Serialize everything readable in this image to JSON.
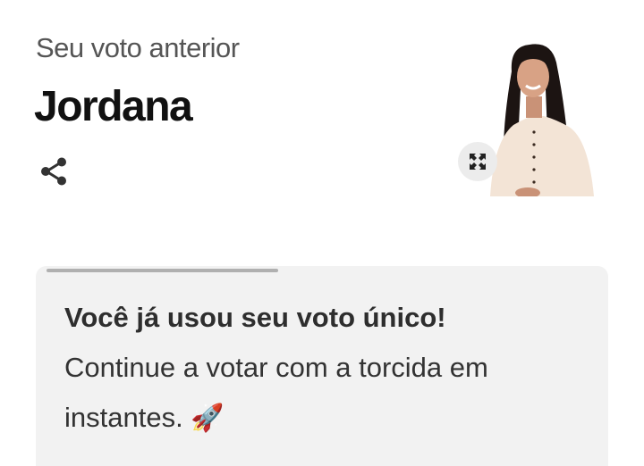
{
  "header": {
    "subtitle": "Seu voto anterior",
    "name": "Jordana",
    "share_icon": "share-icon",
    "expand_icon": "expand-icon"
  },
  "vote_card": {
    "progress": 0.42,
    "title": "Você já usou seu voto único!",
    "message_line1": "Continue a votar com a torcida em",
    "message_line2": "instantes.",
    "emoji": "🚀"
  },
  "colors": {
    "card_background": "#f2f2f2",
    "progress_fill": "#b0b0b0",
    "text_dark": "#111111",
    "text_muted": "#555555"
  }
}
